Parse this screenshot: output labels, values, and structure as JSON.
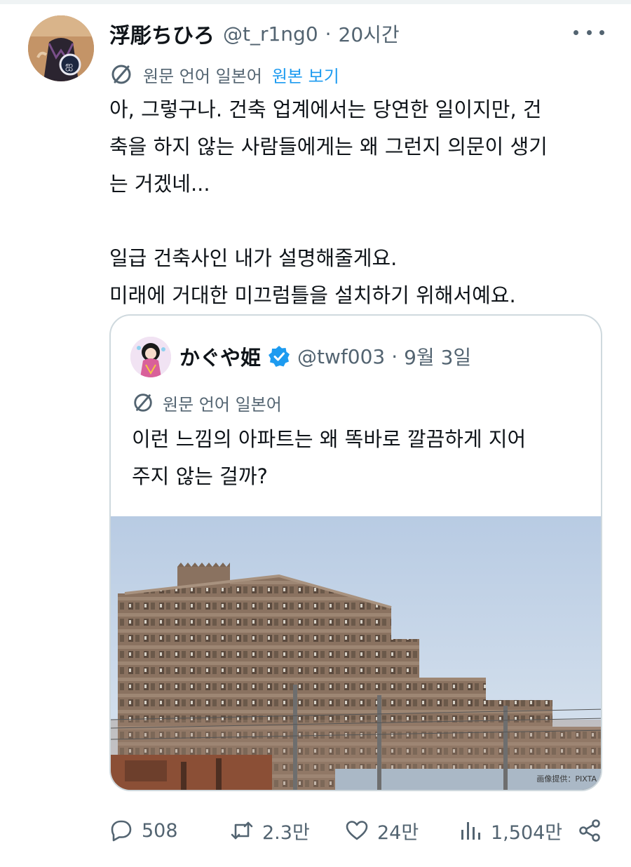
{
  "tweet": {
    "author_name": "浮彫ちひろ",
    "handle": "@t_r1ng0",
    "separator": "·",
    "time": "20시간",
    "translation_label": "원문 언어 일본어",
    "translation_link": "원본 보기",
    "text_lines": [
      "아, 그렇구나. 건축 업계에서는 당연한 일이지만, 건",
      "축을 하지 않는 사람들에게는 왜 그런지 의문이 생기",
      "는 거겠네...",
      "",
      "일급 건축사인 내가 설명해줄게요.",
      "미래에 거대한 미끄럼틀을 설치하기 위해서예요."
    ]
  },
  "quote": {
    "author_name": "かぐや姫",
    "handle": "@twf003",
    "separator": "·",
    "time": "9월 3일",
    "translation_label": "원문 언어 일본어",
    "text_lines": [
      "이런 느낌의 아파트는 왜 똑바로 깔끔하게 지어",
      "주지 않는 걸까?"
    ],
    "image_credit": "画像提供：PIXTA"
  },
  "actions": {
    "replies": "508",
    "retweets": "2.3만",
    "likes": "24만",
    "views": "1,504만"
  },
  "colors": {
    "text": "#0f1419",
    "secondary": "#536471",
    "link": "#1d9bf0",
    "border": "#cfd9de"
  }
}
